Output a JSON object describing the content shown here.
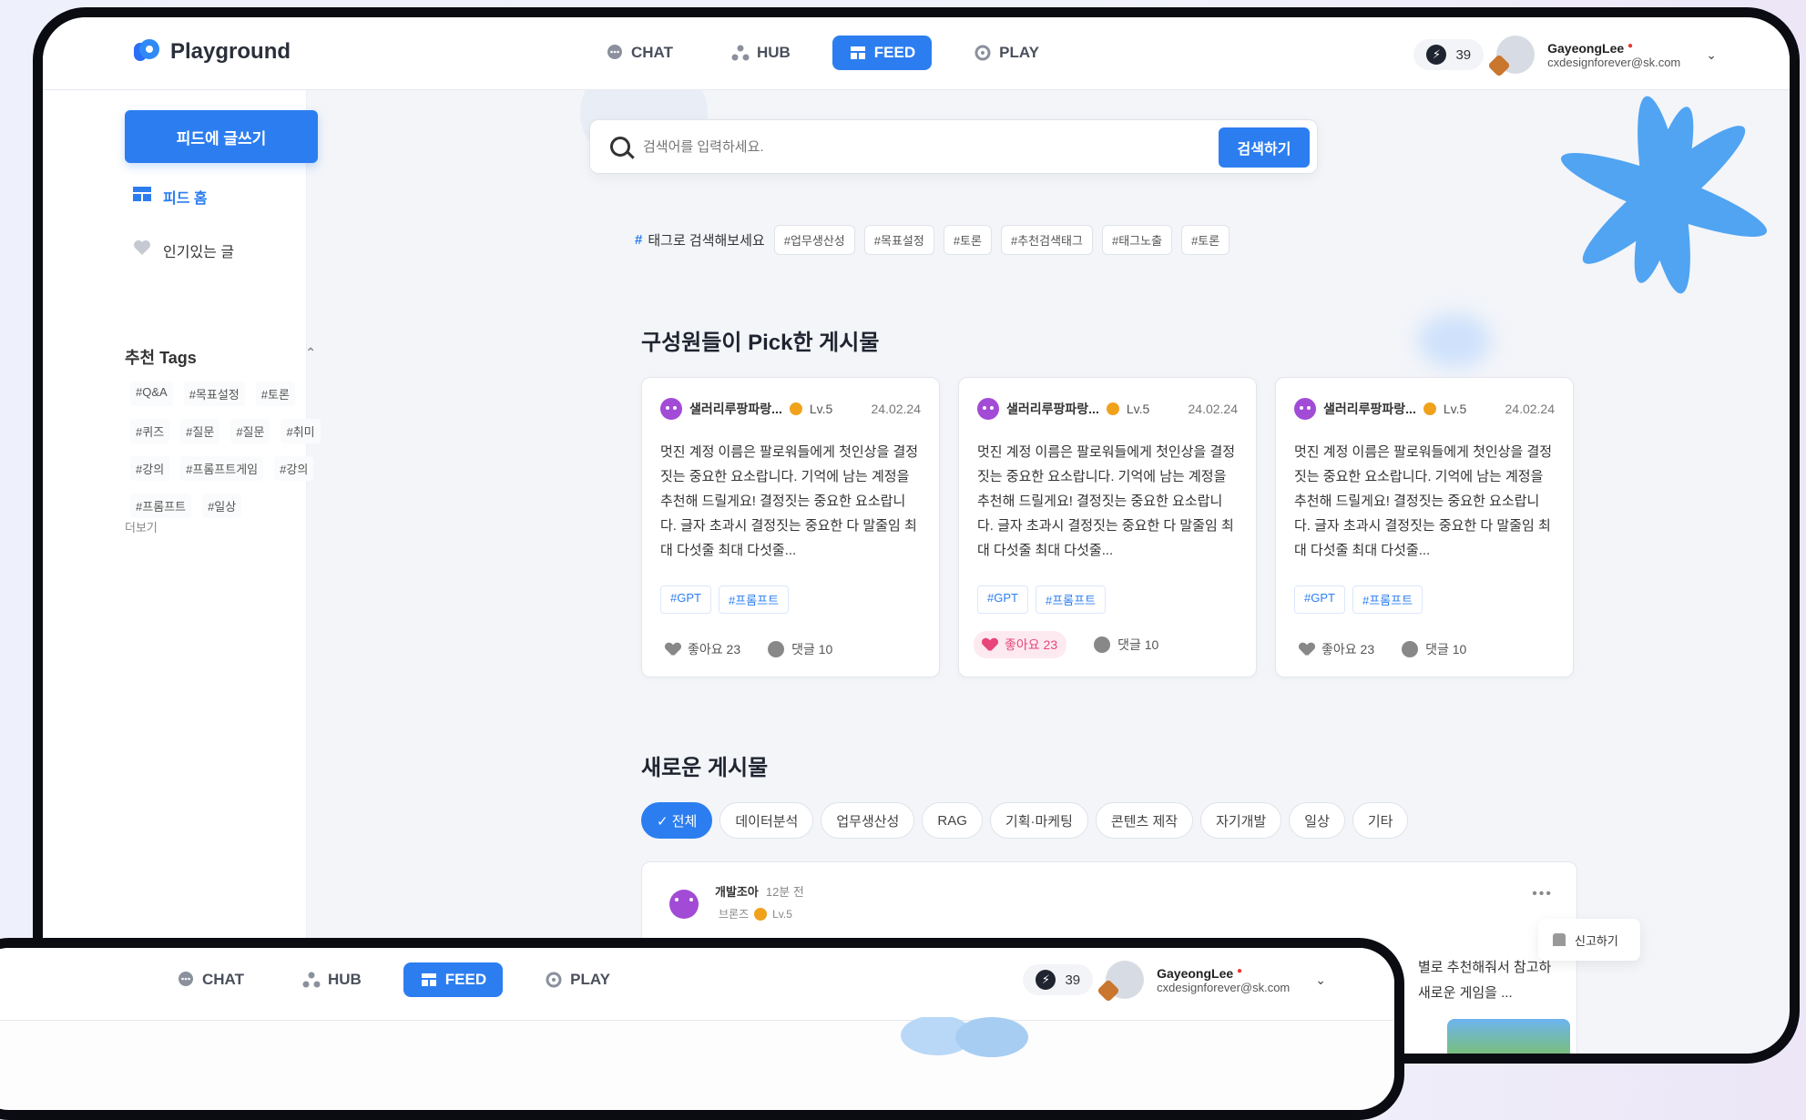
{
  "app": {
    "title": "Playground"
  },
  "nav": [
    {
      "label": "CHAT",
      "icon": "chat-icon"
    },
    {
      "label": "HUB",
      "icon": "hub-icon"
    },
    {
      "label": "FEED",
      "icon": "feed-icon",
      "active": true
    },
    {
      "label": "PLAY",
      "icon": "play-icon"
    }
  ],
  "user": {
    "points": "39",
    "name": "GayeongLee",
    "email": "cxdesignforever@sk.com"
  },
  "sidebar": {
    "write_button": "피드에 글쓰기",
    "links": [
      {
        "label": "피드 홈",
        "icon": "feed-home-icon",
        "active": true
      },
      {
        "label": "인기있는 글",
        "icon": "heart-icon"
      }
    ],
    "tags_title": "추천 Tags",
    "tags": [
      "#Q&A",
      "#목표설정",
      "#토론",
      "#퀴즈",
      "#질문",
      "#질문",
      "#취미",
      "#강의",
      "#프롬프트게임",
      "#강의",
      "#프롬프트",
      "#일상"
    ],
    "more": "더보기"
  },
  "search": {
    "placeholder": "검색어를 입력하세요.",
    "button": "검색하기"
  },
  "tag_search": {
    "label": "태그로 검색해보세요",
    "tags": [
      "#업무생산성",
      "#목표설정",
      "#토론",
      "#추천검색태그",
      "#태그노출",
      "#토론"
    ]
  },
  "picks": {
    "title": "구성원들이 Pick한 게시물",
    "cards": [
      {
        "author": "샐러리루팡파랑...",
        "level": "Lv.5",
        "date": "24.02.24",
        "body": "멋진 계정 이름은 팔로워들에게 첫인상을 결정짓는 중요한 요소랍니다. 기억에 남는 계정을 추천해 드릴게요! 결정짓는 중요한 요소랍니다. 글자 초과시 결정짓는 중요한 다 말줄임 최대 다섯줄 최대 다섯줄...",
        "tags": [
          "#GPT",
          "#프롬프트"
        ],
        "likes": "좋아요 23",
        "comments": "댓글 10",
        "liked": false
      },
      {
        "author": "샐러리루팡파랑...",
        "level": "Lv.5",
        "date": "24.02.24",
        "body": "멋진 계정 이름은 팔로워들에게 첫인상을 결정짓는 중요한 요소랍니다. 기억에 남는 계정을 추천해 드릴게요! 결정짓는 중요한 요소랍니다. 글자 초과시 결정짓는 중요한 다 말줄임 최대 다섯줄 최대 다섯줄...",
        "tags": [
          "#GPT",
          "#프롬프트"
        ],
        "likes": "좋아요 23",
        "comments": "댓글 10",
        "liked": true
      },
      {
        "author": "샐러리루팡파랑...",
        "level": "Lv.5",
        "date": "24.02.24",
        "body": "멋진 계정 이름은 팔로워들에게 첫인상을 결정짓는 중요한 요소랍니다. 기억에 남는 계정을 추천해 드릴게요! 결정짓는 중요한 요소랍니다. 글자 초과시 결정짓는 중요한 다 말줄임 최대 다섯줄 최대 다섯줄...",
        "tags": [
          "#GPT",
          "#프롬프트"
        ],
        "likes": "좋아요 23",
        "comments": "댓글 10",
        "liked": false
      }
    ]
  },
  "new_posts": {
    "title": "새로운 게시물",
    "filters": [
      "✓ 전체",
      "데이터분석",
      "업무생산성",
      "RAG",
      "기획·마케팅",
      "콘텐츠 제작",
      "자기개발",
      "일상",
      "기타"
    ],
    "post": {
      "author": "개발조아",
      "time": "12분 전",
      "rank": "브론즈",
      "level": "Lv.5",
      "snippet_1": "별로 추천해줘서 참고하",
      "snippet_2": "새로운 게임을 ..."
    },
    "report": "신고하기"
  }
}
